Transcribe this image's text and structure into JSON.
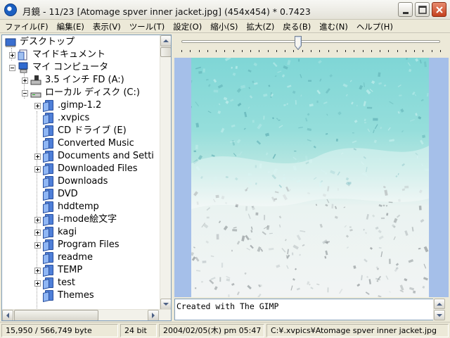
{
  "window": {
    "title": "月鏡 - 11/23 [Atomage spver inner jacket.jpg]  (454x454)  * 0.7423"
  },
  "menu": [
    {
      "label": "ファイル(F)"
    },
    {
      "label": "編集(E)"
    },
    {
      "label": "表示(V)"
    },
    {
      "label": "ツール(T)"
    },
    {
      "label": "設定(O)"
    },
    {
      "label": "縮小(S)"
    },
    {
      "label": "拡大(Z)"
    },
    {
      "label": "戻る(B)"
    },
    {
      "label": "進む(N)"
    },
    {
      "label": "ヘルプ(H)"
    }
  ],
  "tree": {
    "items": [
      {
        "label": "デスクトップ",
        "icon": "desktop-icon"
      },
      {
        "label": "マイドキュメント",
        "icon": "my-documents-icon"
      },
      {
        "label": "マイ コンピュータ",
        "icon": "my-computer-icon"
      },
      {
        "label": "3.5 インチ FD (A:)",
        "icon": "floppy-drive-icon"
      },
      {
        "label": "ローカル ディスク (C:)",
        "icon": "hard-disk-icon"
      },
      {
        "label": ".gimp-1.2",
        "icon": "folder-icon"
      },
      {
        "label": ".xvpics",
        "icon": "folder-icon"
      },
      {
        "label": "CD ドライブ (E)",
        "icon": "folder-icon"
      },
      {
        "label": "Converted Music",
        "icon": "folder-icon"
      },
      {
        "label": "Documents and Setti",
        "icon": "folder-icon"
      },
      {
        "label": "Downloaded Files",
        "icon": "folder-icon"
      },
      {
        "label": "Downloads",
        "icon": "folder-icon"
      },
      {
        "label": "DVD",
        "icon": "folder-icon"
      },
      {
        "label": "hddtemp",
        "icon": "folder-icon"
      },
      {
        "label": "i-mode絵文字",
        "icon": "folder-icon"
      },
      {
        "label": "kagi",
        "icon": "folder-icon"
      },
      {
        "label": "Program Files",
        "icon": "folder-icon"
      },
      {
        "label": "readme",
        "icon": "folder-icon"
      },
      {
        "label": "TEMP",
        "icon": "folder-icon"
      },
      {
        "label": "test",
        "icon": "folder-icon"
      },
      {
        "label": "Themes",
        "icon": "folder-icon"
      }
    ]
  },
  "slider": {
    "position": 0.45
  },
  "viewer": {
    "background_color": "#a5bfe9",
    "comment": "Created with The GIMP"
  },
  "status": {
    "size": "15,950 / 566,749 byte",
    "depth": "24 bit",
    "date": "2004/02/05(木) pm 05:47",
    "path": "C:¥.xvpics¥Atomage spver inner jacket.jpg"
  }
}
